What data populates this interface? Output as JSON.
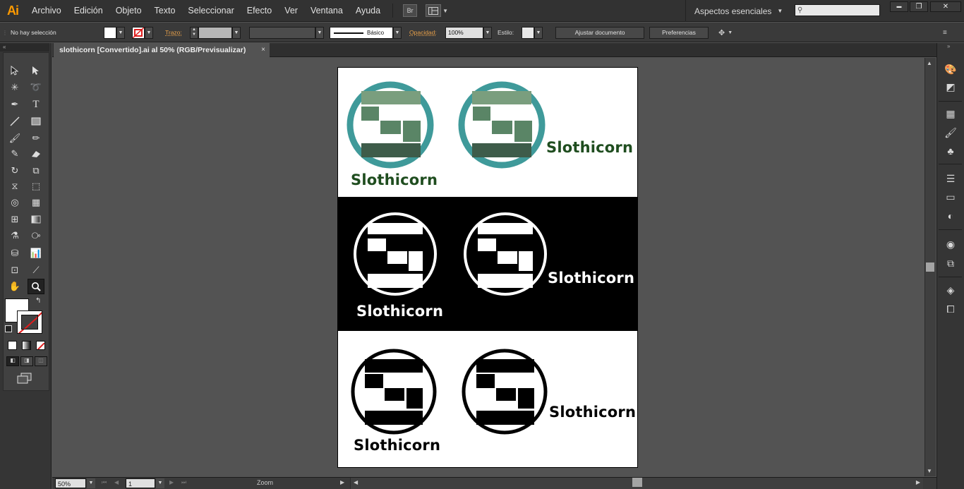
{
  "app": {
    "logo": "Ai"
  },
  "menu": [
    "Archivo",
    "Edición",
    "Objeto",
    "Texto",
    "Seleccionar",
    "Efecto",
    "Ver",
    "Ventana",
    "Ayuda"
  ],
  "toolbar_badges": {
    "bridge": "Br"
  },
  "workspace": {
    "label": "Aspectos esenciales"
  },
  "window_controls": {
    "minimize": "▬",
    "restore": "❐",
    "close": "✕"
  },
  "control_bar": {
    "selection": "No hay selección",
    "stroke_label": "Trazo:",
    "brush_label": "Básico",
    "opacity_label": "Opacidad:",
    "opacity_value": "100%",
    "style_label": "Estilo:",
    "fit_document": "Ajustar documento",
    "preferences": "Preferencias"
  },
  "document": {
    "tab_title": "slothicorn [Convertido].ai al 50% (RGB/Previsualizar)",
    "close": "×"
  },
  "artwork": {
    "wordmark": "Slothicorn",
    "colors": {
      "teal_ring": "#3f9a9a",
      "light_green": "#7a9e7e",
      "mid_green": "#5a8566",
      "dark_green": "#3e5c4a",
      "wordmark_green": "#1f4d1f",
      "black": "#000000",
      "white": "#ffffff"
    }
  },
  "status_bar": {
    "zoom": "50%",
    "page": "1",
    "tool": "Zoom"
  },
  "icons": {
    "search": "search-icon",
    "caret": "chevron-down-icon"
  }
}
